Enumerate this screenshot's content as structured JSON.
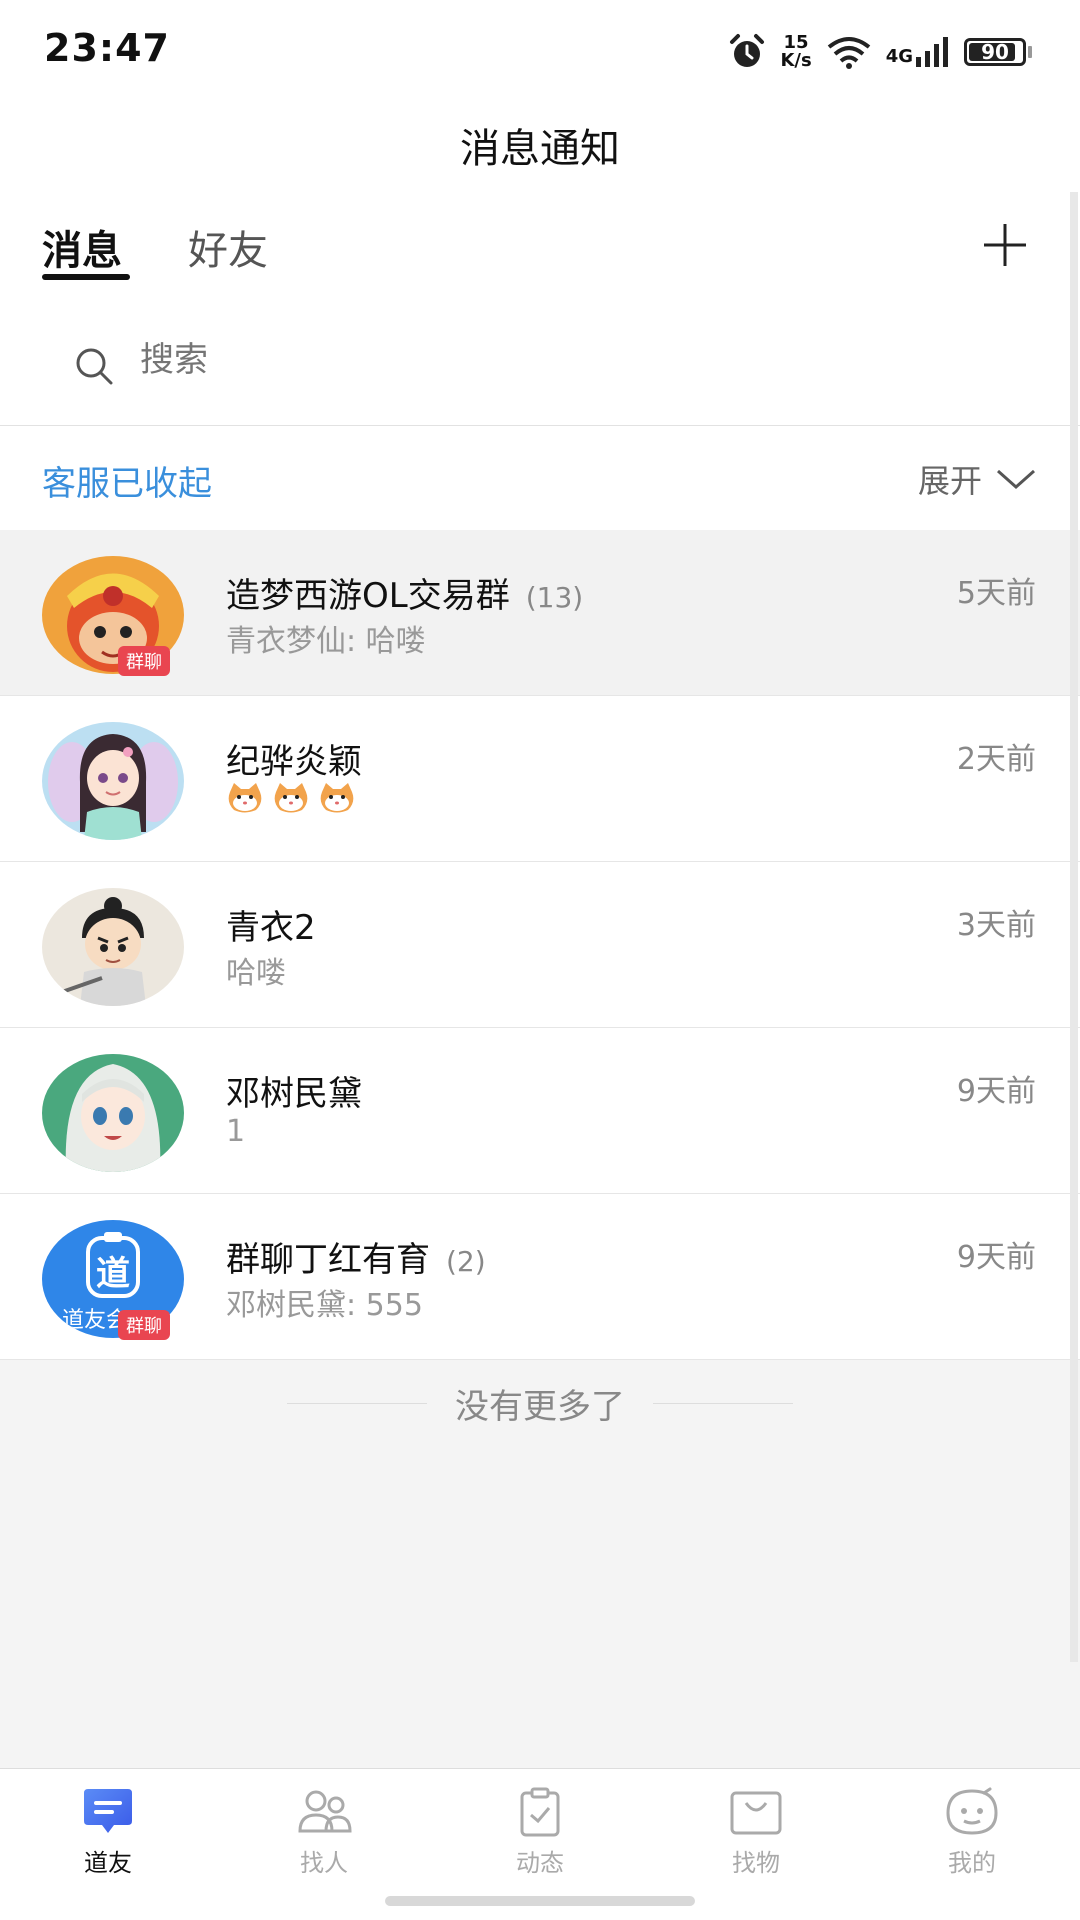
{
  "status_bar": {
    "time": "23:47",
    "speed_value": "15",
    "speed_unit": "K/s",
    "network": "4G",
    "battery": "90",
    "battery_level": 0.9,
    "icons": [
      "alarm-icon",
      "wifi-icon",
      "signal-icon",
      "battery-icon"
    ]
  },
  "header": {
    "title": "消息通知"
  },
  "tabs": [
    {
      "label": "消息",
      "active": true
    },
    {
      "label": "好友",
      "active": false
    }
  ],
  "search": {
    "placeholder": "搜索"
  },
  "service": {
    "label": "客服已收起",
    "expand_label": "展开"
  },
  "chats": [
    {
      "name": "造梦西游OL交易群",
      "count": "(13)",
      "preview": "青衣梦仙: 哈喽",
      "time": "5天前",
      "badge": "群聊",
      "avatar_icon": "monkey-king-avatar"
    },
    {
      "name": "纪骅炎颖",
      "count": "",
      "preview": "",
      "time": "2天前",
      "badge": "",
      "avatar_icon": "fairy-girl-avatar",
      "preview_icons": [
        "cat-emoji-icon",
        "cat-emoji-icon",
        "cat-emoji-icon"
      ]
    },
    {
      "name": "青衣2",
      "count": "",
      "preview": "哈喽",
      "time": "3天前",
      "badge": "",
      "avatar_icon": "swordsman-avatar"
    },
    {
      "name": "邓树民黛",
      "count": "",
      "preview": "1",
      "time": "9天前",
      "badge": "",
      "avatar_icon": "anime-girl-avatar"
    },
    {
      "name": "群聊丁红有育",
      "count": "(2)",
      "preview": "邓树民黛: 555",
      "time": "9天前",
      "badge": "群聊",
      "avatar_icon": "daoyouhui-logo-avatar",
      "avatar_text": "道友会",
      "avatar_logo_char": "道"
    }
  ],
  "list_footer": "没有更多了",
  "bottom_nav": [
    {
      "label": "道友",
      "icon": "chat-icon",
      "active": true
    },
    {
      "label": "找人",
      "icon": "people-icon",
      "active": false
    },
    {
      "label": "动态",
      "icon": "clipboard-icon",
      "active": false
    },
    {
      "label": "找物",
      "icon": "bag-icon",
      "active": false
    },
    {
      "label": "我的",
      "icon": "face-icon",
      "active": false
    }
  ],
  "colors": {
    "accent_blue": "#3a8fdc",
    "badge_red": "#e94550",
    "nav_active": "#4a6cf0"
  }
}
